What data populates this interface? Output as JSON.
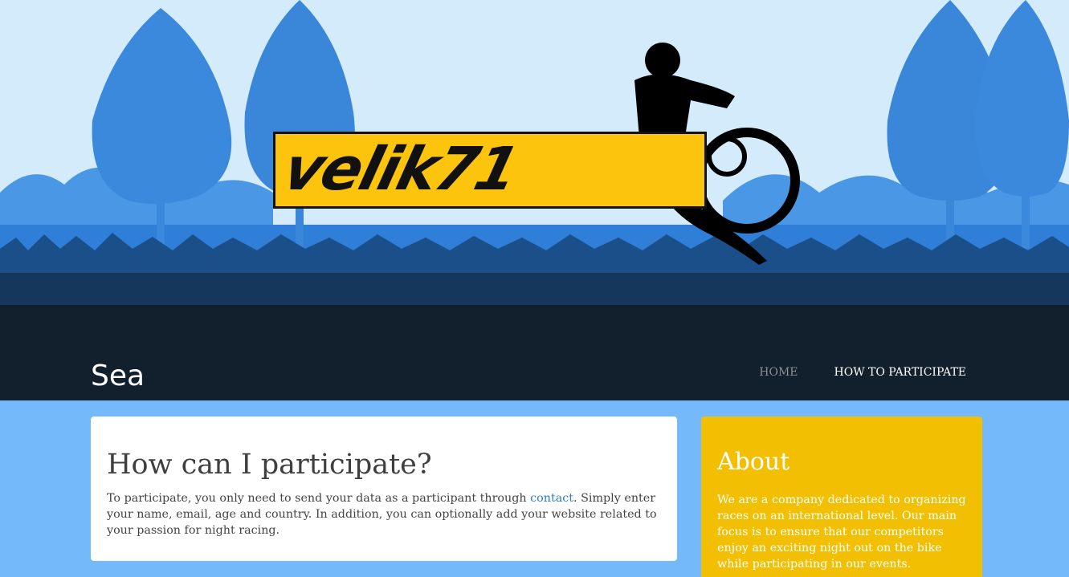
{
  "header": {
    "logo_text": "velik71",
    "site_title": "Sea"
  },
  "nav": {
    "items": [
      {
        "label": "HOME"
      },
      {
        "label": "HOW TO PARTICIPATE"
      }
    ]
  },
  "main": {
    "heading": "How can I participate?",
    "paragraph_before_link": "To participate, you only need to send your data as a participant through ",
    "link_text": "contact",
    "paragraph_after_link": ". Simply enter your name, email, age and country. In addition, you can optionally add your website related to your passion for night racing."
  },
  "sidebar": {
    "heading": "About",
    "text": "We are a company dedicated to organizing races on an international level. Our main focus is to ensure that our competitors enjoy an exciting night out on the bike while participating in our events."
  },
  "colors": {
    "sky": "#d4ebfb",
    "header_dark": "#121f2d",
    "page_background": "#74bafb",
    "logo_yellow": "#fcc40d",
    "about_yellow": "#f3bf03",
    "link_blue": "#2d7fc4"
  }
}
